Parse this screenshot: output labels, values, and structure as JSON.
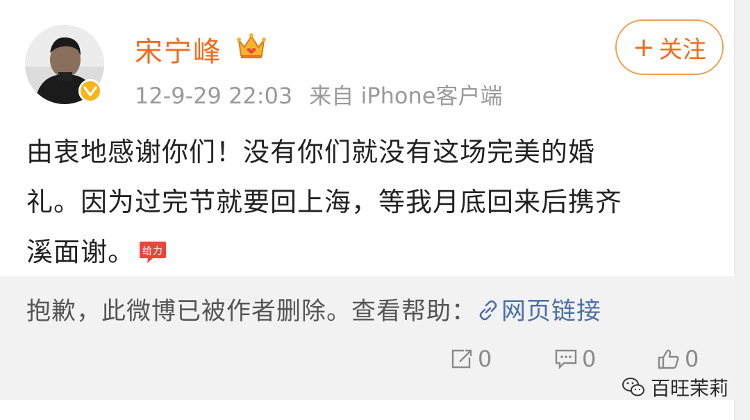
{
  "user": {
    "name": "宋宁峰",
    "timestamp": "12-9-29 22:03",
    "source": "来自 iPhone客户端",
    "verified": true
  },
  "follow_button": {
    "label": "关注",
    "plus": "+"
  },
  "post": {
    "lines": [
      "由衷地感谢你们！没有你们就没有这场完美的婚",
      "礼。因为过完节就要回上海，等我月底回来后携齐",
      "溪面谢。"
    ],
    "emoji_text": "给力"
  },
  "repost": {
    "message": "抱歉，此微博已被作者删除。查看帮助：",
    "link_label": "网页链接"
  },
  "actions": {
    "repost_count": "0",
    "comment_count": "0",
    "like_count": "0"
  },
  "watermark": {
    "text": "百旺茉莉"
  },
  "colors": {
    "accent": "#f26b1d",
    "link": "#4a6ea8",
    "gray_bg": "#f2f2f2"
  }
}
